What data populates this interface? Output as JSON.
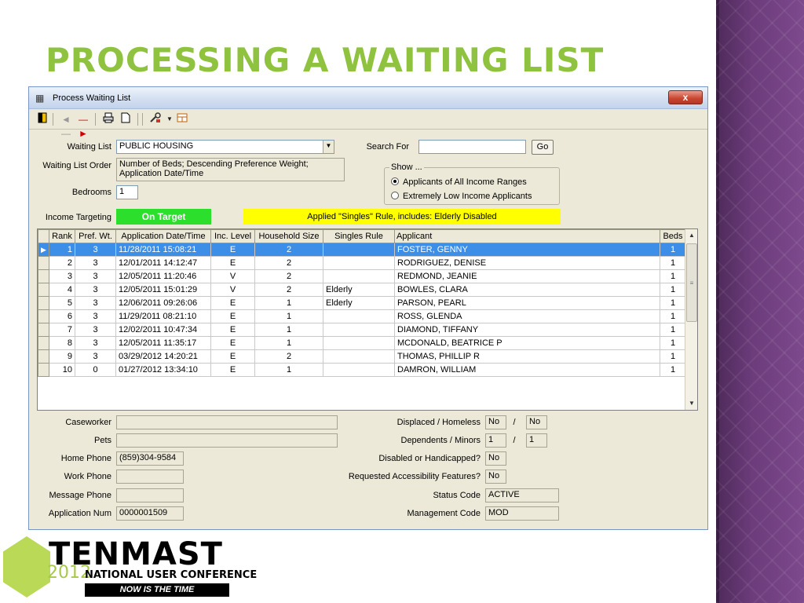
{
  "slide": {
    "title": "PROCESSING A WAITING LIST"
  },
  "window": {
    "title": "Process Waiting List",
    "close_label": "x"
  },
  "toolbar": {
    "icons": [
      "exit-icon",
      "back-arrow-icon",
      "forward-arrow-icon",
      "print-icon",
      "new-document-icon",
      "tools-icon",
      "dropdown-arrow-icon",
      "export-icon"
    ]
  },
  "form": {
    "waiting_list_label": "Waiting List",
    "waiting_list_value": "PUBLIC HOUSING",
    "search_for_label": "Search For",
    "search_for_value": "",
    "go_label": "Go",
    "order_label": "Waiting List Order",
    "order_value_line1": "Number of Beds; Descending Preference Weight;",
    "order_value_line2": "Application Date/Time",
    "bedrooms_label": "Bedrooms",
    "bedrooms_value": "1",
    "show_label": "Show ...",
    "show_opt1": "Applicants of All Income Ranges",
    "show_opt2": "Extremely Low Income Applicants",
    "income_targeting_label": "Income Targeting",
    "on_target_label": "On Target",
    "singles_rule_text": "Applied \"Singles\" Rule, includes:  Elderly  Disabled"
  },
  "grid": {
    "columns": [
      "Rank",
      "Pref. Wt.",
      "Application Date/Time",
      "Inc. Level",
      "Household Size",
      "Singles Rule",
      "Applicant",
      "Beds"
    ],
    "rows": [
      {
        "rank": "1",
        "pref": "3",
        "date": "11/28/2011 15:08:21",
        "inc": "E",
        "hh": "2",
        "singles": "",
        "applicant": "FOSTER, GENNY",
        "beds": "1"
      },
      {
        "rank": "2",
        "pref": "3",
        "date": "12/01/2011 14:12:47",
        "inc": "E",
        "hh": "2",
        "singles": "",
        "applicant": "RODRIGUEZ, DENISE",
        "beds": "1"
      },
      {
        "rank": "3",
        "pref": "3",
        "date": "12/05/2011 11:20:46",
        "inc": "V",
        "hh": "2",
        "singles": "",
        "applicant": "REDMOND, JEANIE",
        "beds": "1"
      },
      {
        "rank": "4",
        "pref": "3",
        "date": "12/05/2011 15:01:29",
        "inc": "V",
        "hh": "2",
        "singles": "Elderly",
        "applicant": "BOWLES, CLARA",
        "beds": "1"
      },
      {
        "rank": "5",
        "pref": "3",
        "date": "12/06/2011 09:26:06",
        "inc": "E",
        "hh": "1",
        "singles": "Elderly",
        "applicant": "PARSON, PEARL",
        "beds": "1"
      },
      {
        "rank": "6",
        "pref": "3",
        "date": "11/29/2011 08:21:10",
        "inc": "E",
        "hh": "1",
        "singles": "",
        "applicant": "ROSS, GLENDA",
        "beds": "1"
      },
      {
        "rank": "7",
        "pref": "3",
        "date": "12/02/2011 10:47:34",
        "inc": "E",
        "hh": "1",
        "singles": "",
        "applicant": "DIAMOND, TIFFANY",
        "beds": "1"
      },
      {
        "rank": "8",
        "pref": "3",
        "date": "12/05/2011 11:35:17",
        "inc": "E",
        "hh": "1",
        "singles": "",
        "applicant": "MCDONALD, BEATRICE P",
        "beds": "1"
      },
      {
        "rank": "9",
        "pref": "3",
        "date": "03/29/2012 14:20:21",
        "inc": "E",
        "hh": "2",
        "singles": "",
        "applicant": "THOMAS, PHILLIP R",
        "beds": "1"
      },
      {
        "rank": "10",
        "pref": "0",
        "date": "01/27/2012 13:34:10",
        "inc": "E",
        "hh": "1",
        "singles": "",
        "applicant": "DAMRON, WILLIAM",
        "beds": "1"
      }
    ]
  },
  "details": {
    "caseworker_label": "Caseworker",
    "caseworker_value": "",
    "pets_label": "Pets",
    "pets_value": "",
    "home_phone_label": "Home Phone",
    "home_phone_value": "(859)304-9584",
    "work_phone_label": "Work Phone",
    "work_phone_value": "",
    "message_phone_label": "Message Phone",
    "message_phone_value": "",
    "application_num_label": "Application Num",
    "application_num_value": "0000001509",
    "displaced_label": "Displaced / Homeless",
    "displaced_value": "No",
    "homeless_value": "No",
    "dependents_label": "Dependents / Minors",
    "dependents_value": "1",
    "minors_value": "1",
    "disabled_label": "Disabled or Handicapped?",
    "disabled_value": "No",
    "accessibility_label": "Requested Accessibility Features?",
    "accessibility_value": "No",
    "status_code_label": "Status Code",
    "status_code_value": "ACTIVE",
    "management_code_label": "Management Code",
    "management_code_value": "MOD",
    "slash": "/"
  },
  "logo": {
    "brand": "TENMAST",
    "year": "2012",
    "conference": "NATIONAL USER CONFERENCE",
    "tagline": "NOW IS THE TIME"
  },
  "colors": {
    "title_green": "#8fc33f",
    "on_target_green": "#2ddf2d",
    "rule_yellow": "#ffff00",
    "selection_blue": "#3d8ee6",
    "side_purple": "#6b3b7a"
  }
}
